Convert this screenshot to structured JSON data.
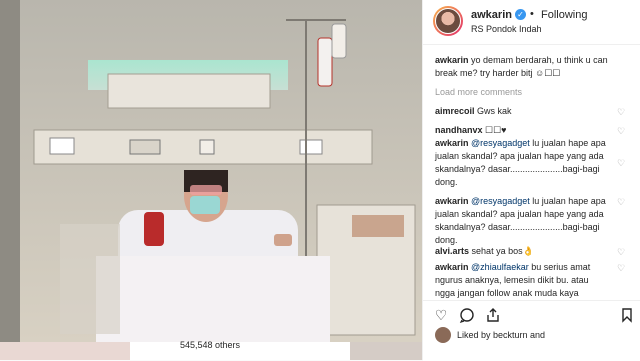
{
  "post": {
    "username": "awkarin",
    "follow_separator": "•",
    "follow_label": "Following",
    "location": "RS Pondok Indah"
  },
  "caption": {
    "user": "awkarin",
    "text": "yo demam berdarah, u think u can break me? try harder bitj ☺☐☐"
  },
  "load_more_label": "Load more comments",
  "comments": [
    {
      "user": "aimrecoil",
      "text": "Gws kak"
    },
    {
      "user": "nandhanvx",
      "text": "☐☐♥"
    },
    {
      "user": "awkarin",
      "mention": "@resyagadget",
      "text": " lu jualan hape apa jualan skandal? apa jualan hape yang ada skandalnya? dasar.....................bagi-bagi dong."
    },
    {
      "user": "awkarin",
      "mention": "@resyagadget",
      "text": " lu jualan hape apa jualan skandal? apa jualan hape yang ada skandalnya? dasar.....................bagi-bagi dong."
    },
    {
      "user": "alvi.arts",
      "text": "sehat ya bos👌"
    },
    {
      "user": "awkarin",
      "mention": "@zhiaulfaekar",
      "text": " bu serius amat ngurus anaknya, lemesin dikit bu. atau ngga jangan follow anak muda kaya"
    }
  ],
  "likes": {
    "liked_by_label": "Liked by beckturn and",
    "others_label": "545,548 others"
  },
  "icons": [
    "heart-icon",
    "comment-icon",
    "share-icon",
    "bookmark-icon",
    "verified-icon",
    "more-icon"
  ],
  "colors": {
    "accent": "#3897f0",
    "text": "#262626",
    "muted": "#999999",
    "mention": "#003569"
  }
}
